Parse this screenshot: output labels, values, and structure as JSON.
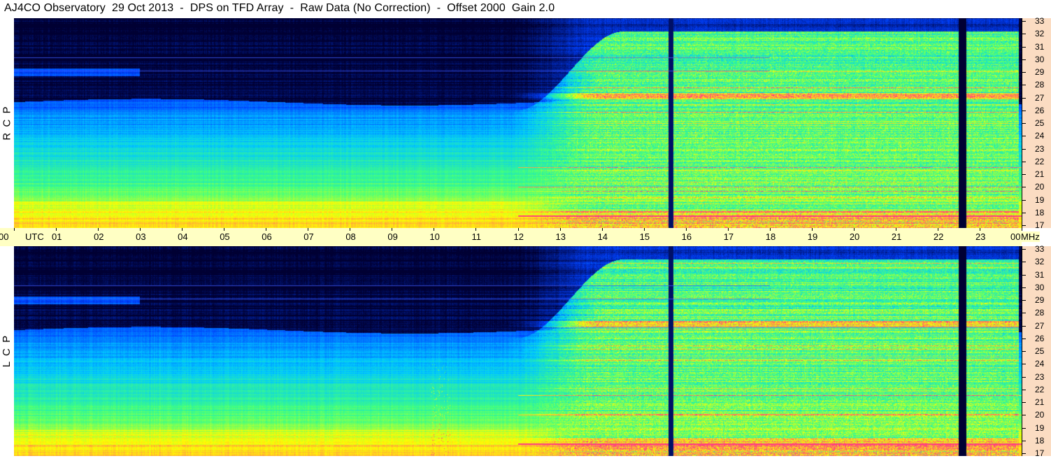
{
  "header": {
    "title": "AJ4CO Observatory  29 Oct 2013  -  DPS on TFD Array  -  Raw Data (No Correction)  -  Offset 2000  Gain 2.0"
  },
  "panels": {
    "top": {
      "label": "R  C  P"
    },
    "bottom": {
      "label": "L  C  P"
    }
  },
  "time_axis": {
    "utc_label": "UTC",
    "labels": [
      "00",
      "01",
      "02",
      "03",
      "04",
      "05",
      "06",
      "07",
      "08",
      "09",
      "10",
      "11",
      "12",
      "13",
      "14",
      "15",
      "16",
      "17",
      "18",
      "19",
      "20",
      "21",
      "22",
      "23",
      "00"
    ]
  },
  "freq_axis": {
    "unit_label": "MHz",
    "labels": [
      "33",
      "32",
      "31",
      "30",
      "29",
      "28",
      "27",
      "26",
      "25",
      "24",
      "23",
      "22",
      "21",
      "20",
      "19",
      "18",
      "17"
    ]
  },
  "chart_data": {
    "type": "heatmap",
    "title": "AJ4CO Observatory  29 Oct 2013  -  DPS on TFD Array  -  Raw Data (No Correction)  -  Offset 2000  Gain 2.0",
    "xlabel": "UTC",
    "ylabel": "MHz",
    "xlim": [
      0,
      24
    ],
    "ylim": [
      17,
      33
    ],
    "x_ticks": [
      0,
      1,
      2,
      3,
      4,
      5,
      6,
      7,
      8,
      9,
      10,
      11,
      12,
      13,
      14,
      15,
      16,
      17,
      18,
      19,
      20,
      21,
      22,
      23,
      24
    ],
    "y_ticks": [
      17,
      18,
      19,
      20,
      21,
      22,
      23,
      24,
      25,
      26,
      27,
      28,
      29,
      30,
      31,
      32,
      33
    ],
    "panels": [
      "R  C  P",
      "L  C  P"
    ],
    "colormap": [
      "#000033",
      "#0040ff",
      "#00c8ff",
      "#40ff80",
      "#ffff00",
      "#ff4080"
    ],
    "features": {
      "daytime_activity_start_utc": 12,
      "daytime_activity_end_utc": 24,
      "strong_band_mhz": [
        26.8,
        27.3
      ],
      "dropout_lines_utc": [
        15.65,
        22.6
      ]
    }
  }
}
